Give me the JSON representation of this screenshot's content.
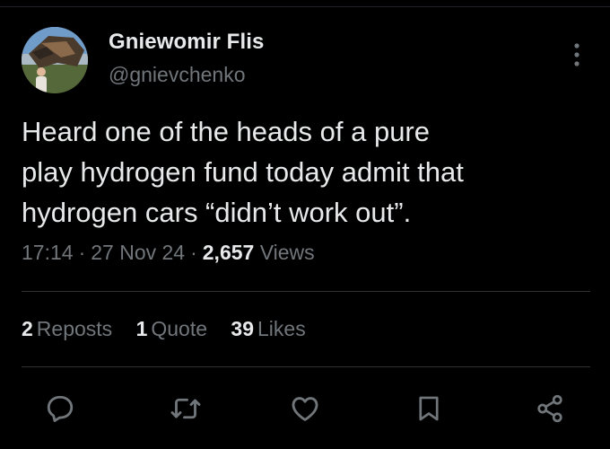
{
  "author": {
    "display_name": "Gniewomir Flis",
    "handle": "@gnievchenko"
  },
  "tweet": {
    "text": "Heard one of the heads of a pure\nplay hydrogen fund today admit that\nhydrogen cars “didn’t work out”.",
    "time": "17:14",
    "date": "27 Nov 24",
    "separator": "·",
    "views_count": "2,657",
    "views_label": "Views"
  },
  "stats": {
    "reposts_count": "2",
    "reposts_label": "Reposts",
    "quotes_count": "1",
    "quotes_label": "Quote",
    "likes_count": "39",
    "likes_label": "Likes"
  },
  "icons": {
    "more": "more-vertical-icon",
    "reply": "reply-icon",
    "repost": "repost-icon",
    "like": "heart-icon",
    "bookmark": "bookmark-icon",
    "share": "share-icon"
  },
  "colors": {
    "background": "#000000",
    "primary_text": "#e7e9ea",
    "secondary_text": "#71767b",
    "divider": "#2f3336"
  }
}
